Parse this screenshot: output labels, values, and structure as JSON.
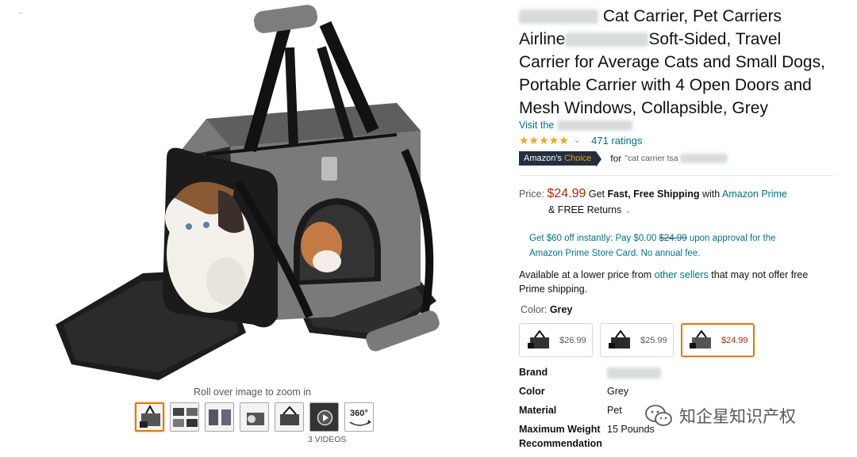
{
  "product": {
    "title_part1": "Cat Carrier, Pet Carriers",
    "title_part2_prefix": "Airline",
    "title_part2_suffix": "Soft-Sided, Travel",
    "title_part3": "Carrier for Average Cats and Small Dogs,",
    "title_part4": "Portable Carrier with 4 Open Doors and",
    "title_part5": "Mesh Windows, Collapsible, Grey",
    "store_link_prefix": "Visit the",
    "stars": "★★★★★",
    "ratings": "471 ratings",
    "badge_prefix": "Amazon's",
    "badge_choice": "Choice",
    "for_label": "for",
    "for_query": "\"cat carrier tsa"
  },
  "price": {
    "label": "Price:",
    "value": "$24.99",
    "get_text": "Get",
    "shipping_bold": "Fast, Free Shipping",
    "with_text": "with",
    "prime": "Amazon Prime",
    "returns": "& FREE Returns"
  },
  "card_offer": {
    "line1_a": "Get $60 off instantly: Pay $0.00",
    "line1_strike": "$24.99",
    "line1_b": "upon approval for the",
    "line2": "Amazon Prime Store Card. No annual fee."
  },
  "availability": {
    "text_a": "Available at a lower price from",
    "link": "other sellers",
    "text_b": "that may not offer free",
    "text_c": "Prime shipping."
  },
  "color": {
    "label": "Color:",
    "value": "Grey",
    "options": [
      {
        "price": "$26.99"
      },
      {
        "price": "$25.99"
      },
      {
        "price": "$24.99"
      }
    ]
  },
  "specs": [
    {
      "key": "Brand",
      "value": ""
    },
    {
      "key": "Color",
      "value": "Grey"
    },
    {
      "key": "Material",
      "value": "Pet"
    },
    {
      "key": "Maximum Weight",
      "value": "15 Pounds"
    },
    {
      "key": "Recommendation",
      "value": ""
    }
  ],
  "gallery": {
    "zoom_hint": "Roll over image to zoom in",
    "videos_label": "3 VIDEOS",
    "view360": "360°"
  },
  "watermark": "知企星知识产权",
  "colors": {
    "link": "#007185",
    "price": "#b12704",
    "star": "#f4a41c",
    "selected_border": "#e77600",
    "badge_bg": "#232f3e"
  }
}
